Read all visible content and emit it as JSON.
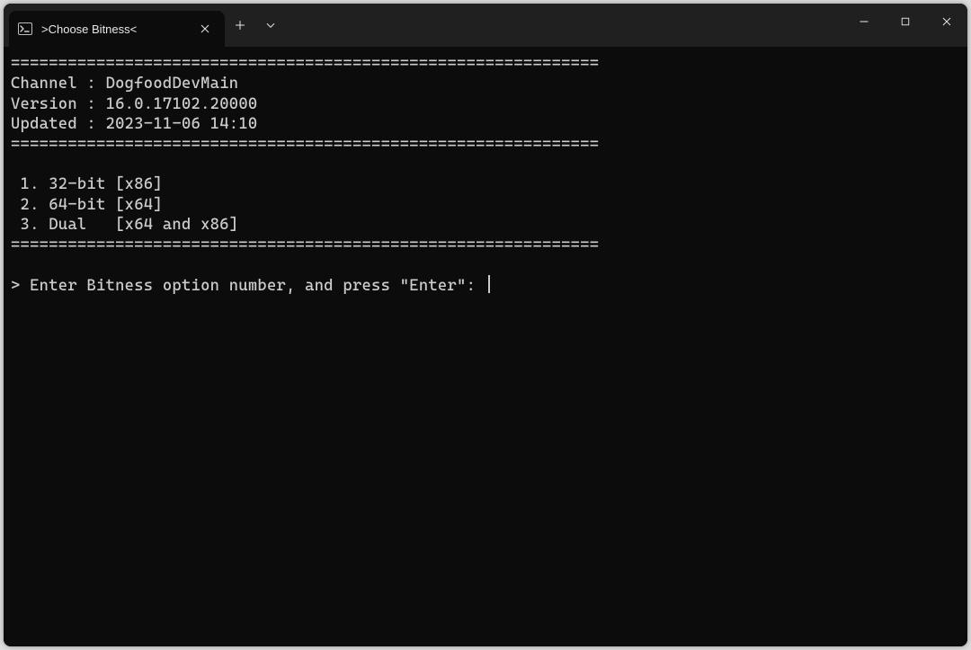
{
  "tab": {
    "title": ">Choose Bitness<"
  },
  "terminal": {
    "divider": "==============================================================",
    "channel_label": "Channel :",
    "channel_value": "DogfoodDevMain",
    "version_label": "Version :",
    "version_value": "16.0.17102.20000",
    "updated_label": "Updated :",
    "updated_value": "2023-11-06 14:10",
    "options": [
      " 1. 32-bit [x86]",
      " 2. 64-bit [x64]",
      " 3. Dual   [x64 and x86]"
    ],
    "prompt": "> Enter Bitness option number, and press \"Enter\": "
  }
}
